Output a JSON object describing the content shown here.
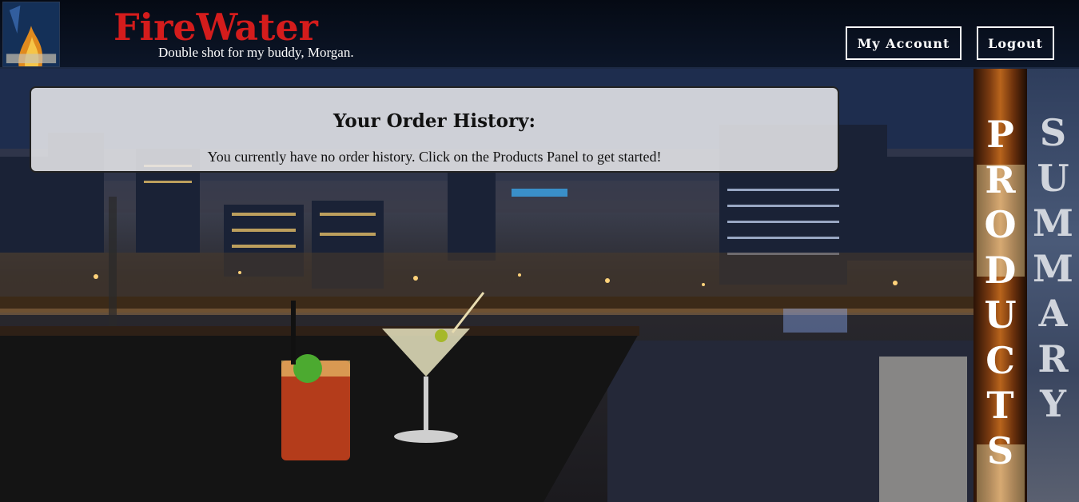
{
  "header": {
    "brand": "FireWater",
    "tagline": "Double shot for my buddy, Morgan.",
    "my_account_label": "My Account",
    "logout_label": "Logout"
  },
  "order_panel": {
    "title": "Your Order History:",
    "message": "You currently have no order history. Click on the Products Panel to get started!"
  },
  "side_tabs": {
    "products": [
      "P",
      "R",
      "O",
      "D",
      "U",
      "C",
      "T",
      "S"
    ],
    "summary": [
      "S",
      "U",
      "M",
      "M",
      "A",
      "R",
      "Y"
    ]
  },
  "icons": {
    "logo": "firewater-logo-icon"
  },
  "colors": {
    "brand": "#d41c1c",
    "header_bg": "#0a1222",
    "panel_bg": "#ebebee"
  }
}
